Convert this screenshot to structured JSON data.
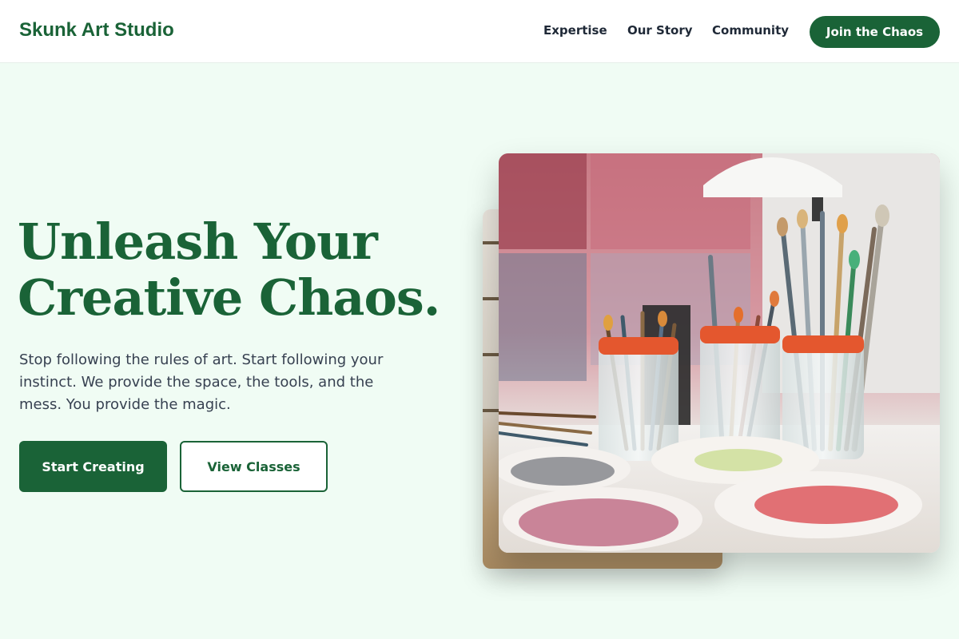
{
  "header": {
    "brand": "Skunk Art Studio",
    "nav": [
      "Expertise",
      "Our Story",
      "Community"
    ],
    "cta": "Join the Chaos"
  },
  "hero": {
    "title_line1": "Unleash Your",
    "title_line2": "Creative Chaos.",
    "subtitle": "Stop following the rules of art. Start following your instinct. We provide the space, the tools, and the mess. You provide the magic.",
    "primary_button": "Start Creating",
    "secondary_button": "View Classes"
  },
  "images": {
    "main_alt": "paint-brushes-in-jars-photo",
    "back_alt": "studio-shelf-photo"
  },
  "colors": {
    "brand_green": "#1a6337",
    "page_background": "#f0fcf4",
    "header_background": "#ffffff"
  }
}
